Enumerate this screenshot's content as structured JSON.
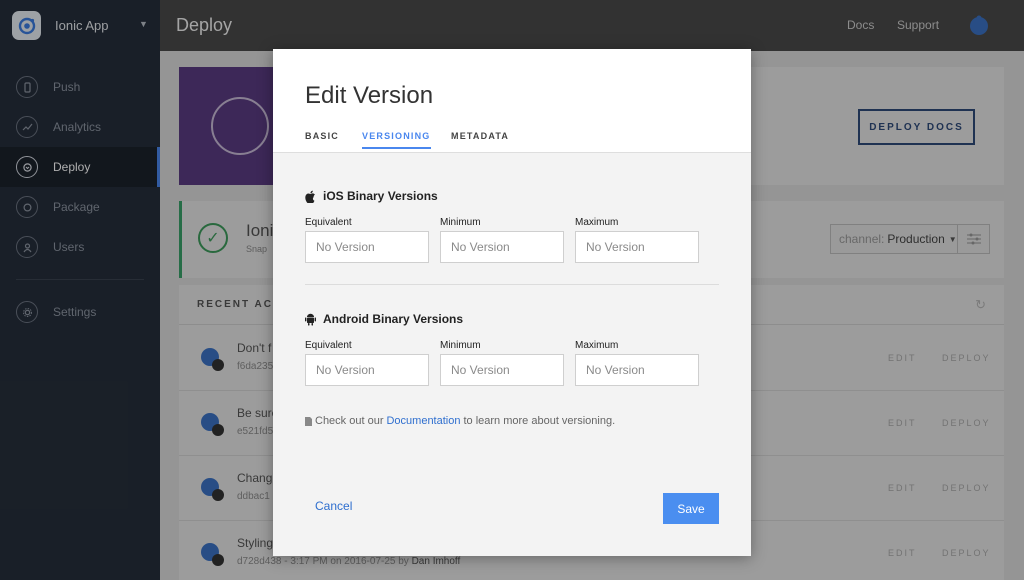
{
  "sidebar": {
    "app_name": "Ionic App",
    "items": [
      {
        "label": "Push",
        "icon": "push-icon"
      },
      {
        "label": "Analytics",
        "icon": "analytics-icon"
      },
      {
        "label": "Deploy",
        "icon": "deploy-icon",
        "active": true
      },
      {
        "label": "Package",
        "icon": "package-icon"
      },
      {
        "label": "Users",
        "icon": "users-icon"
      },
      {
        "label": "Settings",
        "icon": "gear-icon"
      }
    ]
  },
  "header": {
    "title": "Deploy",
    "links": [
      "Docs",
      "Support"
    ]
  },
  "page": {
    "deploy_docs": "DEPLOY DOCS",
    "snapshot_title": "Ioni",
    "snapshot_sub": "Snap",
    "channel_label": "channel:",
    "channel_value": "Production",
    "recent_heading": "RECENT ACTI",
    "rows": [
      {
        "title": "Don't f",
        "meta": "f6da235",
        "author": ""
      },
      {
        "title": "Be sure",
        "meta": "e521fd5",
        "author": ""
      },
      {
        "title": "Chang",
        "meta": "ddbac1",
        "author": ""
      },
      {
        "title": "Styling",
        "meta": "d728d438 - 3:17 PM on 2016-07-25 by",
        "author": "Dan Imhoff"
      }
    ],
    "edit_label": "EDIT",
    "deploy_label": "DEPLOY"
  },
  "modal": {
    "title": "Edit Version",
    "tabs": [
      "BASIC",
      "VERSIONING",
      "METADATA"
    ],
    "active_tab": "VERSIONING",
    "ios_heading": "iOS Binary Versions",
    "android_heading": "Android Binary Versions",
    "field_labels": [
      "Equivalent",
      "Minimum",
      "Maximum"
    ],
    "placeholder": "No Version",
    "help_prefix": "Check out our",
    "help_link": "Documentation",
    "help_suffix": "to learn more about versioning.",
    "cancel": "Cancel",
    "save": "Save"
  },
  "colors": {
    "accent": "#4a87ee",
    "sidebar_bg": "#262f3b",
    "header_bg": "#4a4a4a",
    "success": "#38a169",
    "hero_purple": "#5a3b82"
  }
}
